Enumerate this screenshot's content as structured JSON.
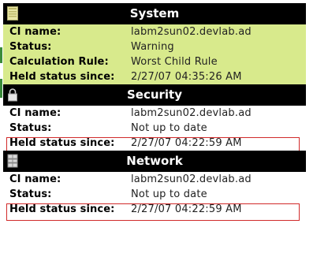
{
  "labels": {
    "ci_name": "CI name:",
    "status": "Status:",
    "calc_rule": "Calculation Rule:",
    "held_since": "Held status since:"
  },
  "system": {
    "title": "System",
    "icon": "document-icon",
    "ci_name": "labm2sun02.devlab.ad",
    "status": "Warning",
    "calc_rule": "Worst Child Rule",
    "held_since": "2/27/07 04:35:26 AM",
    "bg_color": "#d8ea8c"
  },
  "security": {
    "title": "Security",
    "icon": "lock-icon",
    "ci_name": "labm2sun02.devlab.ad",
    "status": "Not up to date",
    "held_since": "2/27/07 04:22:59 AM"
  },
  "network": {
    "title": "Network",
    "icon": "network-icon",
    "ci_name": "labm2sun02.devlab.ad",
    "status": "Not up to date",
    "held_since": "2/27/07 04:22:59 AM"
  },
  "colors": {
    "header_bg": "#000000",
    "header_text": "#ffffff",
    "highlight_border": "#d12a2a"
  }
}
